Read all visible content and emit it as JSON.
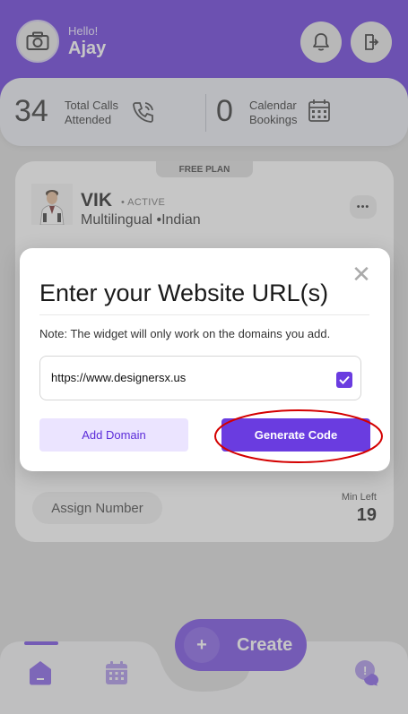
{
  "header": {
    "greeting": "Hello!",
    "user_name": "Ajay"
  },
  "stats": {
    "calls_count": "34",
    "calls_label_line1": "Total Calls",
    "calls_label_line2": "Attended",
    "bookings_count": "0",
    "bookings_label_line1": "Calendar",
    "bookings_label_line2": "Bookings"
  },
  "agent": {
    "plan": "FREE PLAN",
    "name": "VIK",
    "status": "• ACTIVE",
    "description": "Multilingual •Indian",
    "more": "•••",
    "assign_label": "Assign Number",
    "min_left_label": "Min Left",
    "min_left_value": "19"
  },
  "nav": {
    "create_label": "Create",
    "create_plus": "+"
  },
  "modal": {
    "close": "✕",
    "title": "Enter your Website URL(s)",
    "note": "Note: The widget will only work on the domains you add.",
    "url_value": "https://www.designersx.us",
    "add_domain_label": "Add Domain",
    "generate_label": "Generate Code"
  },
  "colors": {
    "brand_purple": "#6a3ce0",
    "header_purple": "#5b2bd9",
    "highlight_red": "#d40000"
  }
}
